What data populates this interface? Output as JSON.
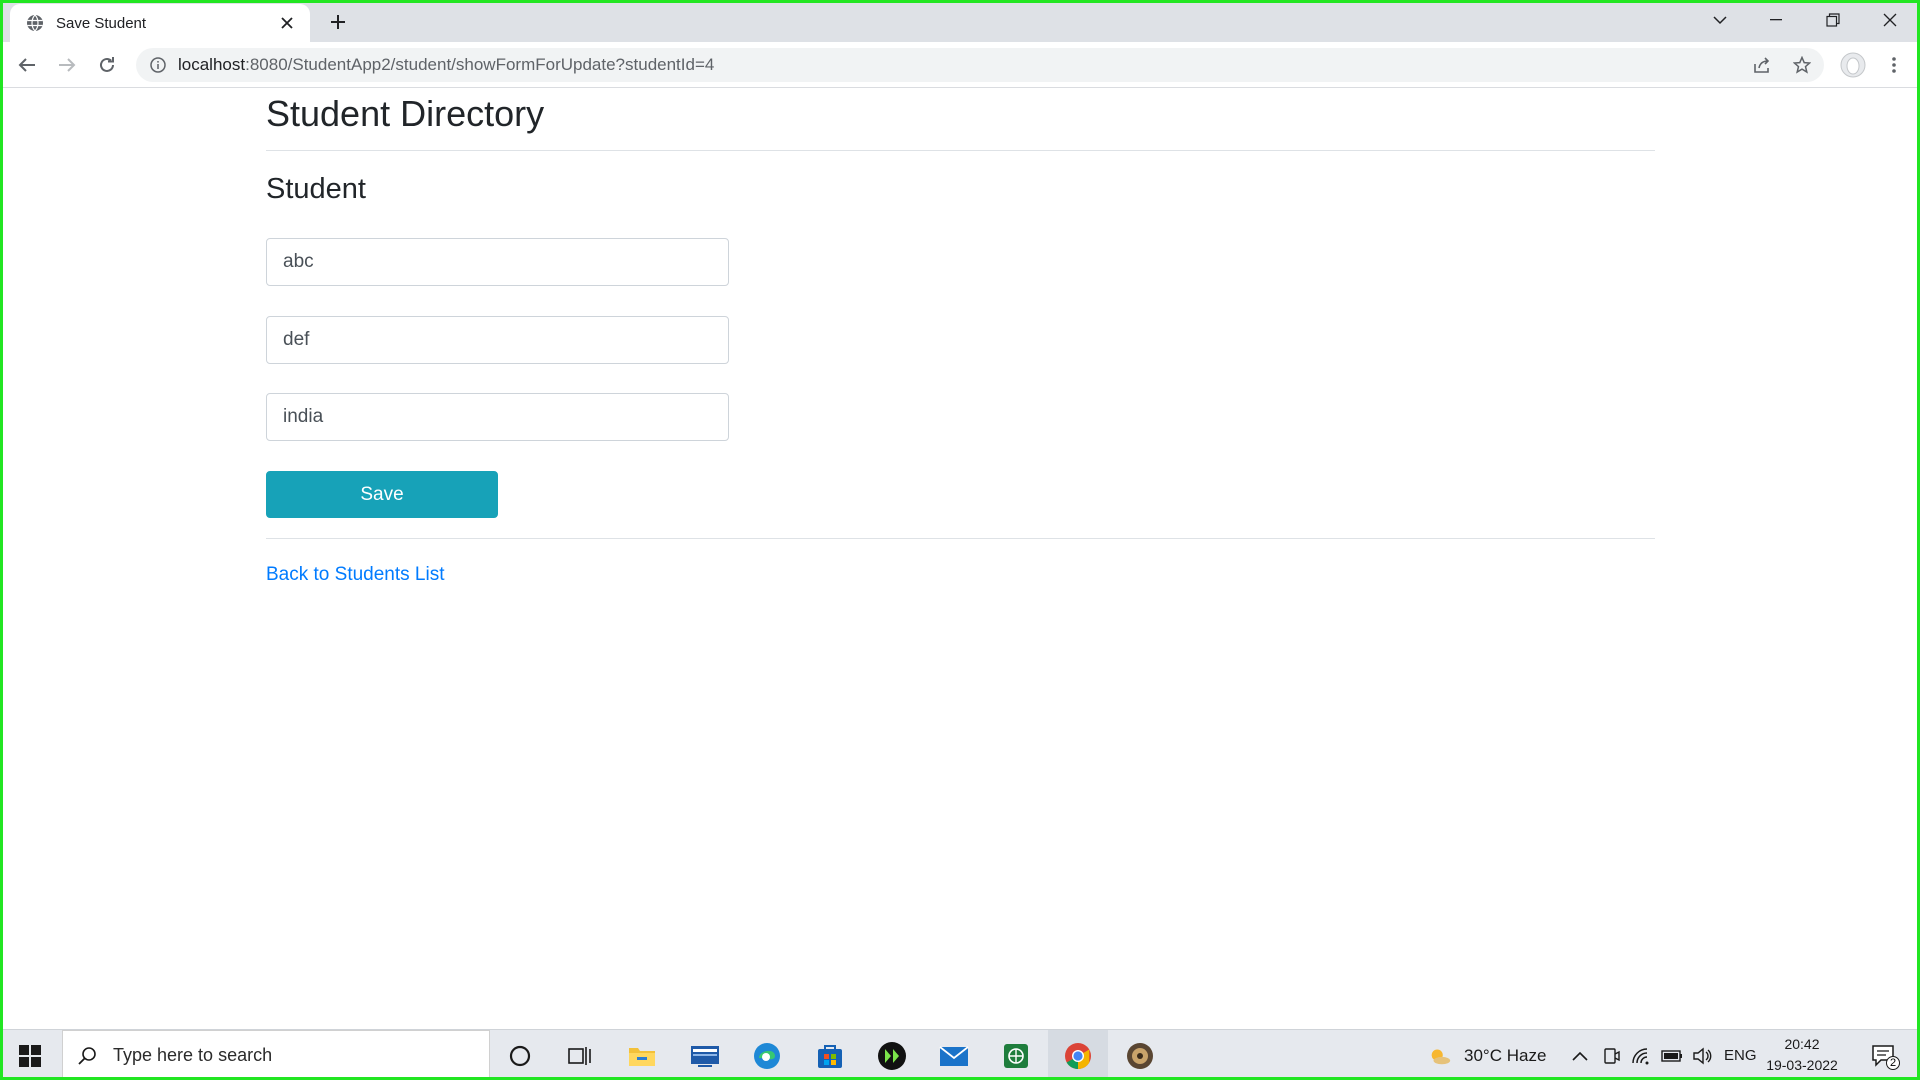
{
  "browser": {
    "tab_title": "Save Student",
    "url_host": "localhost",
    "url_path": ":8080/StudentApp2/student/showFormForUpdate?studentId=4"
  },
  "page": {
    "title": "Student Directory",
    "section_title": "Student",
    "fields": [
      {
        "value": "abc"
      },
      {
        "value": "def"
      },
      {
        "value": "india"
      }
    ],
    "save_label": "Save",
    "back_link_label": "Back to Students List"
  },
  "taskbar": {
    "search_placeholder": "Type here to search",
    "weather": "30°C  Haze",
    "language": "ENG",
    "time": "20:42",
    "date": "19-03-2022",
    "notification_count": "2"
  },
  "colors": {
    "accent_button": "#17a2b8",
    "link": "#007bff",
    "frame": "#22e622"
  }
}
